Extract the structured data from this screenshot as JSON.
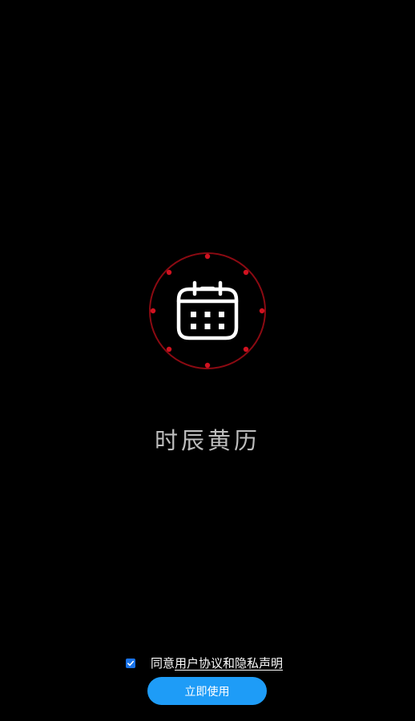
{
  "app": {
    "name": "时辰黄历",
    "logo_icon": "calendar-icon",
    "colors": {
      "background": "#000000",
      "ring": "#8b0a12",
      "ring_dots": "#d01220",
      "accent": "#1e9cf7"
    }
  },
  "agreement": {
    "checked": true,
    "prefix": "同意",
    "link_text": "用户协议和隐私声明"
  },
  "actions": {
    "start_label": "立即使用"
  }
}
